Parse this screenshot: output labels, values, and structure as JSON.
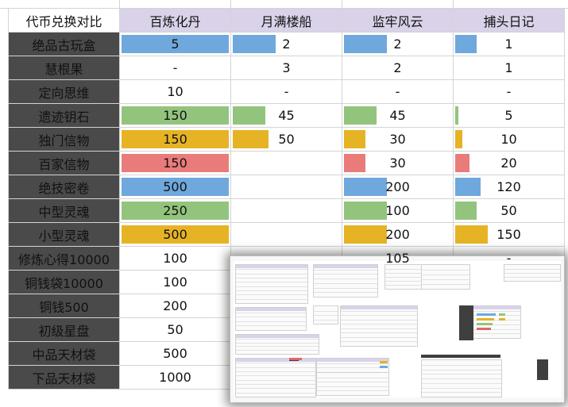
{
  "table": {
    "corner": "代币兑换对比",
    "columns": [
      "百炼化丹",
      "月满楼船",
      "监牢风云",
      "捕头日记"
    ],
    "rows": [
      {
        "label": "绝品古玩盒",
        "cells": [
          {
            "text": "5",
            "fill": 1.0,
            "color": "#6fa8dc"
          },
          {
            "text": "2",
            "fill": 0.4,
            "color": "#6fa8dc"
          },
          {
            "text": "2",
            "fill": 0.4,
            "color": "#6fa8dc"
          },
          {
            "text": "1",
            "fill": 0.2,
            "color": "#6fa8dc"
          }
        ]
      },
      {
        "label": "慧根果",
        "cells": [
          {
            "text": "-"
          },
          {
            "text": "3"
          },
          {
            "text": "2"
          },
          {
            "text": "1"
          }
        ]
      },
      {
        "label": "定向思维",
        "cells": [
          {
            "text": "10"
          },
          {
            "text": "-"
          },
          {
            "text": "-"
          },
          {
            "text": "-"
          }
        ]
      },
      {
        "label": "遗迹钥石",
        "cells": [
          {
            "text": "150",
            "fill": 1.0,
            "color": "#93c47d"
          },
          {
            "text": "45",
            "fill": 0.3,
            "color": "#93c47d"
          },
          {
            "text": "45",
            "fill": 0.3,
            "color": "#93c47d"
          },
          {
            "text": "5",
            "fill": 0.033,
            "color": "#93c47d"
          }
        ]
      },
      {
        "label": "独门信物",
        "cells": [
          {
            "text": "150",
            "fill": 1.0,
            "color": "#e6b325"
          },
          {
            "text": "50",
            "fill": 0.333,
            "color": "#e6b325"
          },
          {
            "text": "30",
            "fill": 0.2,
            "color": "#e6b325"
          },
          {
            "text": "10",
            "fill": 0.067,
            "color": "#e6b325"
          }
        ]
      },
      {
        "label": "百家信物",
        "cells": [
          {
            "text": "150",
            "fill": 1.0,
            "color": "#ea7b7b"
          },
          {
            "text": ""
          },
          {
            "text": "30",
            "fill": 0.2,
            "color": "#ea7b7b"
          },
          {
            "text": "20",
            "fill": 0.133,
            "color": "#ea7b7b"
          }
        ]
      },
      {
        "label": "绝技密卷",
        "cells": [
          {
            "text": "500",
            "fill": 1.0,
            "color": "#6fa8dc"
          },
          {
            "text": ""
          },
          {
            "text": "200",
            "fill": 0.4,
            "color": "#6fa8dc"
          },
          {
            "text": "120",
            "fill": 0.24,
            "color": "#6fa8dc"
          }
        ]
      },
      {
        "label": "中型灵魂",
        "cells": [
          {
            "text": "250",
            "fill": 1.0,
            "color": "#93c47d"
          },
          {
            "text": ""
          },
          {
            "text": "100",
            "fill": 0.4,
            "color": "#93c47d"
          },
          {
            "text": "50",
            "fill": 0.2,
            "color": "#93c47d"
          }
        ]
      },
      {
        "label": "小型灵魂",
        "cells": [
          {
            "text": "500",
            "fill": 1.0,
            "color": "#e6b325"
          },
          {
            "text": ""
          },
          {
            "text": "200",
            "fill": 0.4,
            "color": "#e6b325"
          },
          {
            "text": "150",
            "fill": 0.3,
            "color": "#e6b325"
          }
        ]
      },
      {
        "label": "修炼心得10000",
        "cells": [
          {
            "text": "100"
          },
          {
            "text": ""
          },
          {
            "text": "105"
          },
          {
            "text": "-"
          }
        ]
      },
      {
        "label": "铜钱袋10000",
        "cells": [
          {
            "text": "100"
          },
          {
            "text": ""
          },
          {
            "text": ""
          },
          {
            "text": ""
          }
        ]
      },
      {
        "label": "铜钱500",
        "cells": [
          {
            "text": "200"
          },
          {
            "text": ""
          },
          {
            "text": ""
          },
          {
            "text": ""
          }
        ]
      },
      {
        "label": "初级星盘",
        "cells": [
          {
            "text": "50"
          },
          {
            "text": ""
          },
          {
            "text": ""
          },
          {
            "text": ""
          }
        ]
      },
      {
        "label": "中品天材袋",
        "cells": [
          {
            "text": "500"
          },
          {
            "text": ""
          },
          {
            "text": ""
          },
          {
            "text": ""
          }
        ]
      },
      {
        "label": "下品天材袋",
        "cells": [
          {
            "text": "1000"
          },
          {
            "text": ""
          },
          {
            "text": ""
          },
          {
            "text": ""
          }
        ]
      }
    ]
  },
  "overview_popup": {
    "accent_header": "#d9d2e9",
    "accent_dark": "#3f3f3f",
    "accent_red": "#e06666",
    "accent_blue": "#6fa8dc",
    "accent_green": "#93c47d",
    "accent_yellow": "#e6b325"
  }
}
